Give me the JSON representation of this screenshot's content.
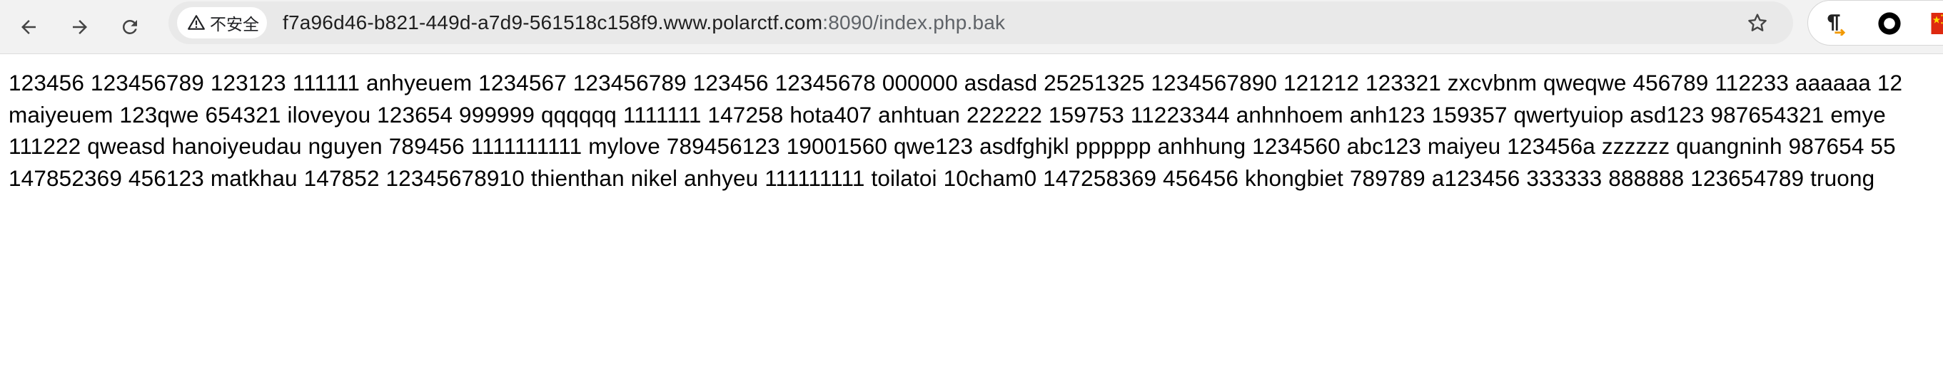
{
  "browser": {
    "security_label": "不安全",
    "url_host": "f7a96d46-b821-449d-a7d9-561518c158f9.www.polarctf.com",
    "url_path": ":8090/index.php.bak"
  },
  "icons": {
    "back": "back-arrow-icon",
    "forward": "forward-arrow-icon",
    "reload": "reload-icon",
    "security": "warning-triangle-icon",
    "bookmark": "star-icon",
    "extensions": [
      "pilcrow-extension-icon",
      "circle-extension-icon",
      "china-flag-extension-icon"
    ]
  },
  "colors": {
    "toolbar_bg": "#f2f2f2",
    "omnibox_bg": "#e9e9e9",
    "page_bg": "#ffffff",
    "text": "#000000",
    "flag_red": "#de2910",
    "flag_yellow": "#ffde00",
    "pilcrow_accent": "#f29900"
  },
  "page": {
    "lines": [
      "123456 123456789 123123 111111 anhyeuem 1234567 123456789 123456 12345678 000000 asdasd 25251325 1234567890 121212 123321 zxcvbnm qweqwe 456789 112233 aaaaaa 12",
      "maiyeuem 123qwe 654321 iloveyou 123654 999999 qqqqqq 1111111 147258 hota407 anhtuan 222222 159753 11223344 anhnhoem anh123 159357 qwertyuiop asd123 987654321 emye",
      "111222 qweasd hanoiyeudau nguyen 789456 1111111111 mylove 789456123 19001560 qwe123 asdfghjkl pppppp anhhung 1234560 abc123 maiyeu 123456a zzzzzz quangninh 987654 55",
      "147852369 456123 matkhau 147852 12345678910 thienthan nikel anhyeu 111111111 toilatoi 10cham0 147258369 456456 khongbiet 789789 a123456 333333 888888 123654789 truong"
    ]
  }
}
